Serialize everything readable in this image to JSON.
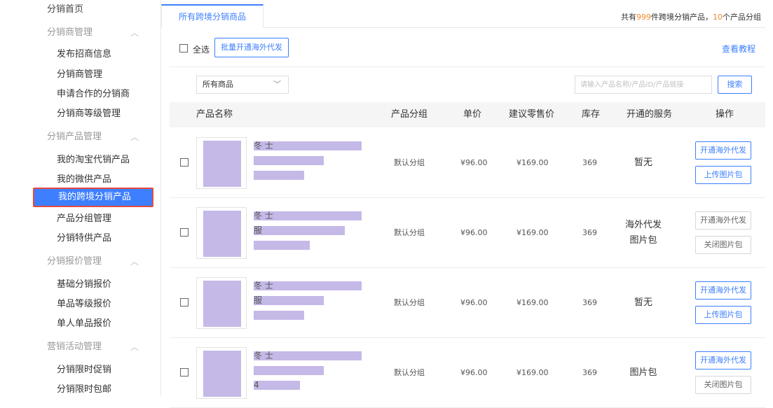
{
  "sidebar": {
    "home": "分销首页",
    "groups": [
      {
        "title": "分销商管理",
        "items": [
          "发布招商信息",
          "分销商管理",
          "申请合作的分销商",
          "分销商等级管理"
        ]
      },
      {
        "title": "分销产品管理",
        "items": [
          "我的淘宝代销产品",
          "我的微供产品",
          "我的跨境分销产品",
          "产品分组管理",
          "分销特供产品"
        ]
      },
      {
        "title": "分销报价管理",
        "items": [
          "基础分销报价",
          "单品等级报价",
          "单人单品报价"
        ]
      },
      {
        "title": "营销活动管理",
        "items": [
          "分销限时促销",
          "分销限时包邮"
        ]
      }
    ],
    "chevron": "^"
  },
  "tabs": {
    "active": "所有跨境分销商品"
  },
  "summary": {
    "prefix": "共有",
    "count": "999",
    "mid": "件跨境分销产品，",
    "groups": "10",
    "suffix": "个产品分组"
  },
  "toolbar": {
    "select_all": "全选",
    "batch_button": "批量开通海外代发",
    "tutorial_link": "查看教程"
  },
  "filter": {
    "select_value": "所有商品",
    "search_placeholder": "请输入产品名称/产品ID/产品链接",
    "search_button": "搜索"
  },
  "table": {
    "headers": {
      "name": "产品名称",
      "group": "产品分组",
      "price": "单价",
      "retail": "建议零售价",
      "stock": "库存",
      "service": "开通的服务",
      "action": "操作"
    },
    "rows": [
      {
        "line1": "冬                              士",
        "line2": "",
        "line3": "",
        "group": "默认分组",
        "price": "¥96.00",
        "retail": "¥169.00",
        "stock": "369",
        "service1": "暂无",
        "service2": "",
        "btn1": "开通海外代发",
        "btn2": "上传图片包",
        "btn1_active": true,
        "btn2_active": true
      },
      {
        "line1": "冬                              士",
        "line2": "                    服",
        "line3": "",
        "group": "默认分组",
        "price": "¥96.00",
        "retail": "¥169.00",
        "stock": "369",
        "service1": "海外代发",
        "service2": "图片包",
        "btn1": "开通海外代发",
        "btn2": "关闭图片包",
        "btn1_active": false,
        "btn2_active": false
      },
      {
        "line1": "冬                              士",
        "line2": "                    服",
        "line3": "",
        "group": "默认分组",
        "price": "¥96.00",
        "retail": "¥169.00",
        "stock": "369",
        "service1": "暂无",
        "service2": "",
        "btn1": "开通海外代发",
        "btn2": "上传图片包",
        "btn1_active": true,
        "btn2_active": true
      },
      {
        "line1": "冬                              士",
        "line2": "",
        "line3": "               4",
        "group": "默认分组",
        "price": "¥96.00",
        "retail": "¥169.00",
        "stock": "369",
        "service1": "图片包",
        "service2": "",
        "btn1": "开通海外代发",
        "btn2": "关闭图片包",
        "btn1_active": true,
        "btn2_active": false
      }
    ]
  },
  "colors": {
    "accent": "#3d7fff",
    "highlight_border": "#e54b3c",
    "count_orange": "#f08a2c",
    "redaction": "#c5b9e8"
  },
  "icons": {
    "select_arrow": "chevron-down-icon",
    "group_toggle": "chevron-up-icon"
  }
}
